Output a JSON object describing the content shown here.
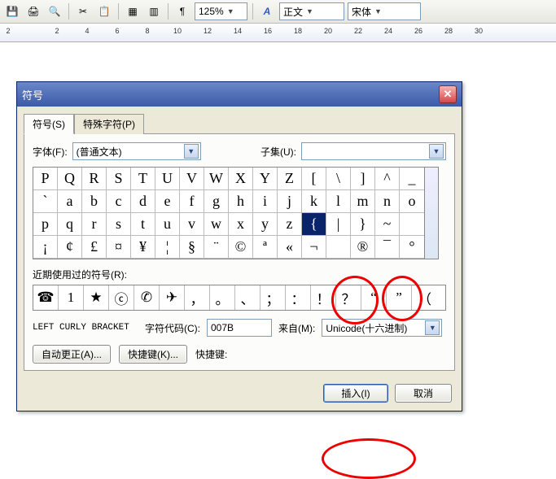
{
  "toolbar": {
    "zoom": "125%",
    "style_label": "正文",
    "font_label": "宋体"
  },
  "ruler": {
    "marks": [
      2,
      2,
      4,
      6,
      8,
      10,
      12,
      14,
      16,
      18,
      20,
      22,
      24,
      26,
      28,
      30
    ]
  },
  "dialog": {
    "title": "符号",
    "tabs": {
      "symbols": "符号(S)",
      "special": "特殊字符(P)"
    },
    "font_label": "字体(F):",
    "font_value": "(普通文本)",
    "subset_label": "子集(U):",
    "subset_value": "",
    "grid": [
      "P",
      "Q",
      "R",
      "S",
      "T",
      "U",
      "V",
      "W",
      "X",
      "Y",
      "Z",
      "[",
      "\\",
      "]",
      "^",
      "_",
      "`",
      "a",
      "b",
      "c",
      "d",
      "e",
      "f",
      "g",
      "h",
      "i",
      "j",
      "k",
      "l",
      "m",
      "n",
      "o",
      "p",
      "q",
      "r",
      "s",
      "t",
      "u",
      "v",
      "w",
      "x",
      "y",
      "z",
      "{",
      "|",
      "}",
      "~",
      "",
      "¡",
      "¢",
      "£",
      "¤",
      "¥",
      "¦",
      "§",
      "¨",
      "©",
      "ª",
      "«",
      "¬",
      "­",
      "®",
      "¯",
      "°"
    ],
    "selected_index": 43,
    "recent_label": "近期使用过的符号(R):",
    "recent": [
      "☎",
      "1",
      "★",
      "ⓒ",
      "✆",
      "✈",
      "，",
      "。",
      "、",
      "；",
      "：",
      "！",
      "？",
      "“",
      "”",
      "（"
    ],
    "char_name": "LEFT CURLY BRACKET",
    "code_label": "字符代码(C):",
    "code_value": "007B",
    "from_label": "来自(M):",
    "from_value": "Unicode(十六进制)",
    "autocorrect_btn": "自动更正(A)...",
    "shortcut_btn": "快捷键(K)...",
    "shortcut_label": "快捷键:",
    "insert_btn": "插入(I)",
    "cancel_btn": "取消"
  }
}
